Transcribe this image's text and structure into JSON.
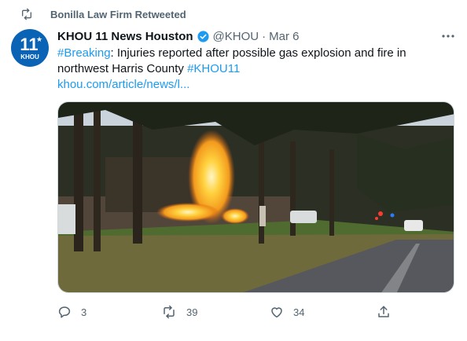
{
  "retweet": {
    "label": "Bonilla Law Firm Retweeted"
  },
  "author": {
    "avatar_text": "11",
    "avatar_sub": "KHOU",
    "name": "KHOU 11 News Houston",
    "handle": "@KHOU",
    "separator": "·",
    "date": "Mar 6"
  },
  "tweet": {
    "hashtag1": "#Breaking",
    "text_part1": ": Injuries reported after possible gas explosion and fire in northwest Harris County ",
    "hashtag2": "#KHOU11",
    "link": "khou.com/article/news/l..."
  },
  "actions": {
    "replies": "3",
    "retweets": "39",
    "likes": "34"
  },
  "colors": {
    "accent": "#1d9bf0",
    "muted": "#536471",
    "brand": "#0b63b6"
  }
}
